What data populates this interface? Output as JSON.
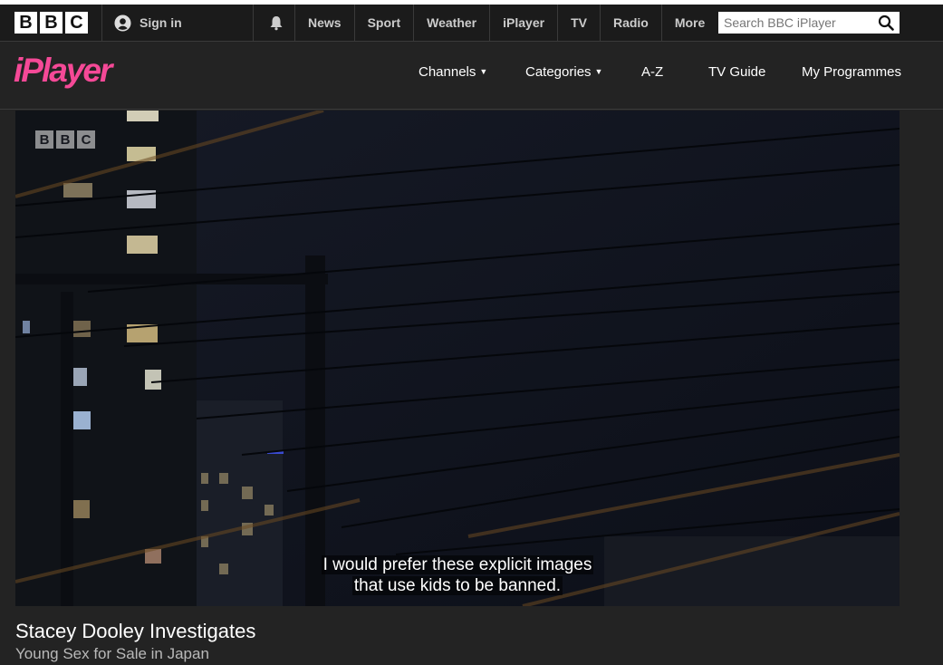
{
  "globalbar": {
    "logo_letters": [
      "B",
      "B",
      "C"
    ],
    "signin_label": "Sign in",
    "nav": [
      "News",
      "Sport",
      "Weather",
      "iPlayer",
      "TV",
      "Radio",
      "More"
    ],
    "search_placeholder": "Search BBC iPlayer"
  },
  "iplayer": {
    "logo": "iPlayer",
    "nav": {
      "channels": "Channels",
      "categories": "Categories",
      "az": "A-Z",
      "tvguide": "TV Guide",
      "myprogrammes": "My Programmes"
    }
  },
  "video": {
    "watermark": [
      "B",
      "B",
      "C"
    ],
    "subtitle_line1": "I would prefer these explicit images",
    "subtitle_line2": "that use kids to be banned."
  },
  "programme": {
    "title": "Stacey Dooley Investigates",
    "episode": "Young Sex for Sale in Japan"
  },
  "colors": {
    "iplayer_pink": "#f54997",
    "background": "#232323",
    "globalbar": "#1b1b1b"
  }
}
